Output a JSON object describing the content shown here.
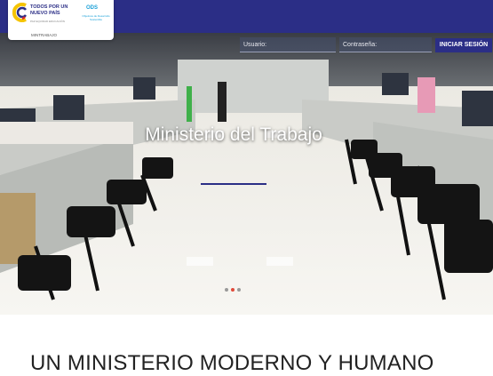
{
  "header": {
    "logo_gov_text": "TODOS POR UN\nNUEVO PAÍS",
    "logo_gov_sub": "PAZ  EQUIDAD  EDUCACIÓN",
    "logo_ods": "ODS",
    "logo_ods_sub": "Objetivos de Desarrollo Sostenible",
    "logo_ministry": "MINTRABAJO"
  },
  "login": {
    "user_placeholder": "Usuario:",
    "password_placeholder": "Contraseña:",
    "button_label": "INICIAR SESIÓN"
  },
  "hero": {
    "title": "Ministerio del Trabajo",
    "slide_count": 3,
    "active_slide": 2
  },
  "section": {
    "title": "UN MINISTERIO MODERNO Y HUMANO"
  },
  "colors": {
    "brand": "#2b2e86",
    "active_dot": "#e04a3a"
  }
}
